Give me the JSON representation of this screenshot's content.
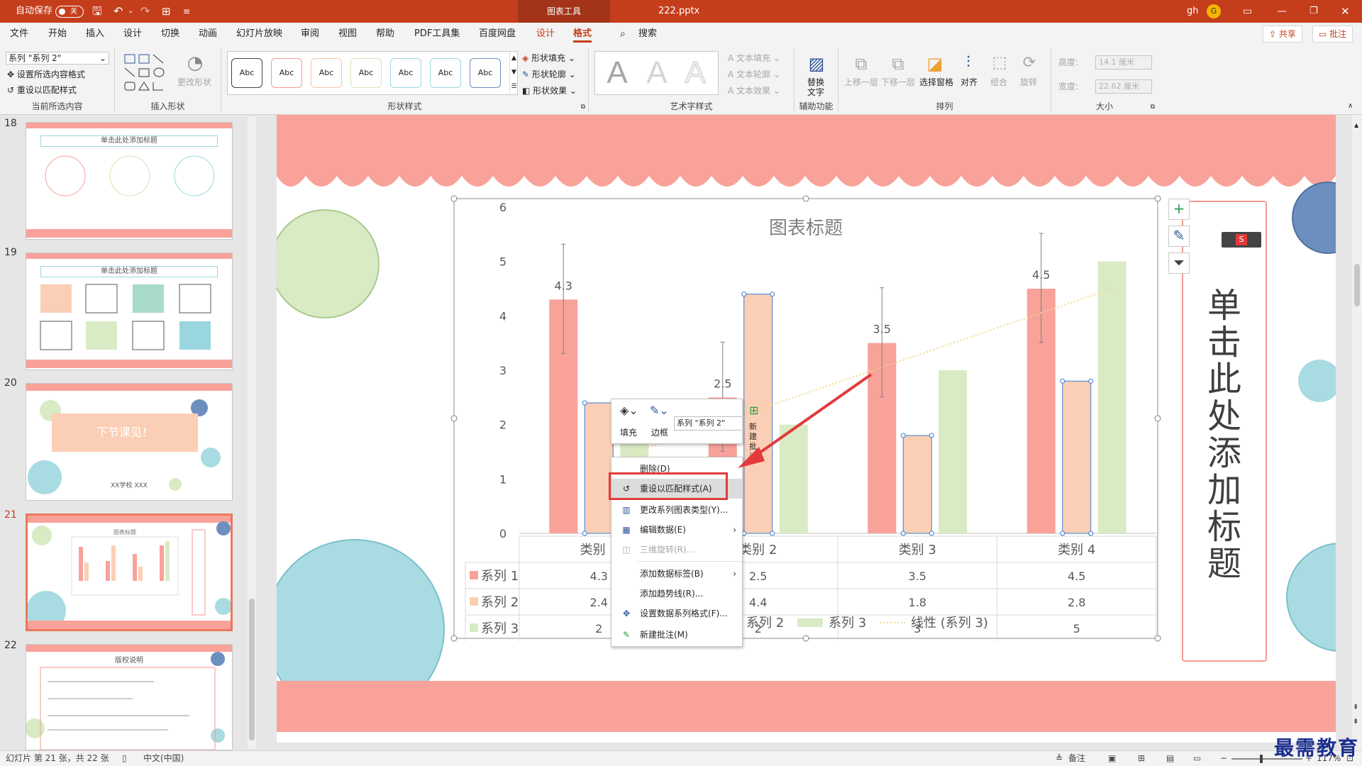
{
  "titlebar": {
    "autosave_label": "自动保存",
    "autosave_state": "关",
    "context_tab": "图表工具",
    "filename": "222.pptx",
    "user": "gh",
    "avatar": "G"
  },
  "menu": {
    "tabs": [
      "文件",
      "开始",
      "插入",
      "设计",
      "切换",
      "动画",
      "幻灯片放映",
      "审阅",
      "视图",
      "帮助",
      "PDF工具集",
      "百度网盘",
      "设计",
      "格式"
    ],
    "active_tab": "格式",
    "search": "搜索",
    "share": "共享",
    "comments": "批注"
  },
  "ribbon": {
    "current_selection": {
      "selected": "系列 \"系列 2\"",
      "format_selection": "设置所选内容格式",
      "reset_style": "重设以匹配样式",
      "label": "当前所选内容"
    },
    "insert_shapes": {
      "change_shape": "更改形状",
      "label": "插入形状"
    },
    "shape_styles": {
      "styles": [
        "Abc",
        "Abc",
        "Abc",
        "Abc",
        "Abc",
        "Abc",
        "Abc"
      ],
      "fill": "形状填充",
      "outline": "形状轮廓",
      "effects": "形状效果",
      "label": "形状样式"
    },
    "wordart": {
      "letters": [
        "A",
        "A",
        "A"
      ],
      "text_fill": "文本填充",
      "text_outline": "文本轮廓",
      "text_effects": "文本效果",
      "label": "艺术字样式"
    },
    "accessibility": {
      "alt_text_1": "替换",
      "alt_text_2": "文字",
      "label": "辅助功能"
    },
    "arrange": {
      "bring_forward": "上移一层",
      "send_backward": "下移一层",
      "selection_pane": "选择窗格",
      "align": "对齐",
      "group": "组合",
      "rotate": "旋转",
      "label": "排列"
    },
    "size": {
      "height_label": "高度:",
      "height_value": "14.1 厘米",
      "width_label": "宽度:",
      "width_value": "22.62 厘米",
      "label": "大小"
    }
  },
  "slides": {
    "numbers": [
      "18",
      "19",
      "20",
      "21",
      "22"
    ],
    "thumb18": {
      "title": "单击此处添加标题"
    },
    "thumb19": {
      "title": "单击此处添加标题"
    },
    "thumb20": {
      "text": "下节课见！",
      "footer": "XX学校 XXX"
    },
    "thumb21": {
      "title": "图表标题"
    },
    "thumb22": {
      "title": "版权说明"
    }
  },
  "slide": {
    "vertical_title": "单击此处添加标题"
  },
  "chart_data": {
    "type": "bar",
    "title": "图表标题",
    "categories": [
      "类别 1",
      "类别 2",
      "类别 3",
      "类别 4"
    ],
    "series": [
      {
        "name": "系列 1",
        "values": [
          4.3,
          2.5,
          3.5,
          4.5
        ],
        "color": "#f8a29a"
      },
      {
        "name": "系列 2",
        "values": [
          2.4,
          4.4,
          1.8,
          2.8
        ],
        "color": "#fbcfb5"
      },
      {
        "name": "系列 3",
        "values": [
          2,
          2,
          3,
          5
        ],
        "color": "#d8ebc4"
      }
    ],
    "data_labels": [
      "4.3",
      "2.5",
      "3.5",
      "4.5"
    ],
    "trendline": "线性 (系列 3)",
    "ylim": [
      0,
      6
    ],
    "yticks": [
      "0",
      "1",
      "2",
      "3",
      "4",
      "5",
      "6"
    ],
    "data_table": [
      [
        "4.3",
        "2.5",
        "3.5",
        "4.5"
      ],
      [
        "2.4",
        "4.4",
        "1.8",
        "2.8"
      ],
      [
        "2",
        "2",
        "3",
        "5"
      ]
    ],
    "legend_visible": [
      "系列 2",
      "系列 3",
      "线性 (系列 3)"
    ]
  },
  "minitoolbar": {
    "fill": "填充",
    "outline": "边框",
    "series_select": "系列 \"系列 2\"",
    "new_comment_1": "新建",
    "new_comment_2": "批注"
  },
  "contextmenu": {
    "items": [
      {
        "label": "删除(D)",
        "icon": ""
      },
      {
        "label": "重设以匹配样式(A)",
        "icon": "↺"
      },
      {
        "label": "更改系列图表类型(Y)...",
        "icon": "▥"
      },
      {
        "label": "编辑数据(E)",
        "icon": "▦"
      },
      {
        "label": "三维旋转(R)...",
        "icon": "◫"
      },
      {
        "label": "添加数据标签(B)",
        "icon": ""
      },
      {
        "label": "添加趋势线(R)...",
        "icon": ""
      },
      {
        "label": "设置数据系列格式(F)...",
        "icon": "✥"
      },
      {
        "label": "新建批注(M)",
        "icon": "✎"
      }
    ]
  },
  "statusbar": {
    "slide_info": "幻灯片 第 21 张，共 22 张",
    "language": "中文(中国)",
    "notes": "备注",
    "zoom": "117%"
  },
  "watermark": "最需教育",
  "colors": {
    "accent": "#c43e1c",
    "arrow": "#e23b3b"
  }
}
